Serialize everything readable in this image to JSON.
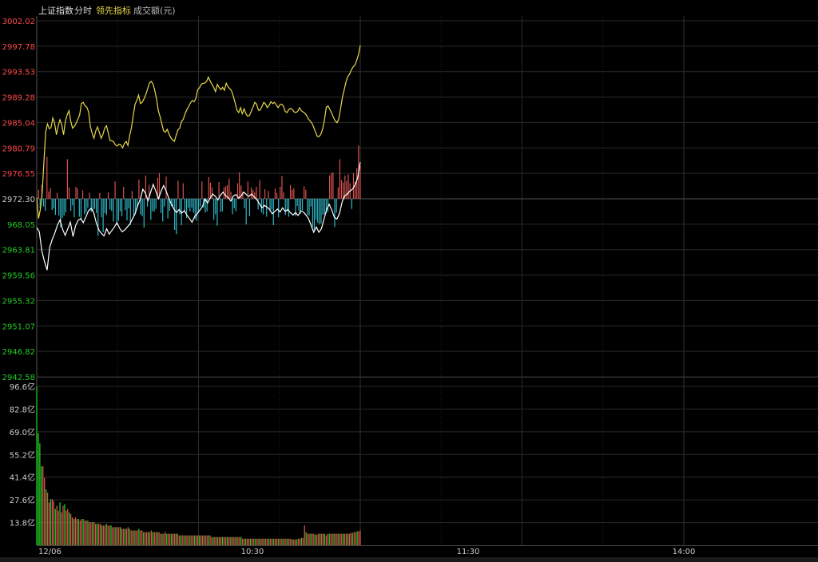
{
  "header": {
    "index_name": "上证指数",
    "tab_time": "分时",
    "tab_leading": "领先指标",
    "turnover_label": "成交额(元)"
  },
  "colors": {
    "up": "#ff4a4a",
    "down": "#22cc22",
    "price_line": "#ffffff",
    "lead_line": "#e8d84a",
    "bar_up": "#d9534f",
    "bar_down": "#2fb8c8",
    "grid": "#2a2a2a"
  },
  "chart_data": [
    {
      "type": "line",
      "panel": "price",
      "prev_close": 2972.3,
      "ylim": [
        2942.58,
        3002.02
      ],
      "y_ticks": [
        "3002.02",
        "2997.78",
        "2993.53",
        "2989.28",
        "2985.04",
        "2980.79",
        "2976.55",
        "2972.30",
        "968.05",
        "2963.81",
        "2959.56",
        "2955.32",
        "2951.07",
        "2946.82",
        "2942.58"
      ],
      "x_labels": [
        "12/06",
        "10:30",
        "11:30",
        "14:00"
      ],
      "x_minutes_shown": 121,
      "x_minutes_total": 241,
      "series": [
        {
          "role": "price",
          "values": [
            2967.5,
            2966.8,
            2963.5,
            2961.8,
            2960.4,
            2964.2,
            2965.5,
            2966.6,
            2967.9,
            2968.8,
            2967.2,
            2966.2,
            2967.3,
            2968.4,
            2966.0,
            2967.8,
            2968.7,
            2969.0,
            2968.3,
            2969.3,
            2970.3,
            2970.7,
            2970.0,
            2968.3,
            2967.1,
            2966.5,
            2966.1,
            2967.3,
            2966.4,
            2967.0,
            2967.6,
            2968.3,
            2967.4,
            2966.8,
            2967.1,
            2967.6,
            2968.1,
            2969.0,
            2969.8,
            2971.2,
            2972.2,
            2973.9,
            2973.2,
            2972.0,
            2973.4,
            2974.7,
            2973.6,
            2972.3,
            2973.5,
            2974.5,
            2973.6,
            2972.4,
            2971.4,
            2970.6,
            2970.0,
            2970.5,
            2969.9,
            2970.3,
            2969.6,
            2969.0,
            2968.4,
            2969.3,
            2969.8,
            2970.4,
            2971.0,
            2972.3,
            2971.6,
            2972.4,
            2973.1,
            2972.7,
            2972.1,
            2972.9,
            2973.4,
            2972.8,
            2972.5,
            2971.9,
            2972.8,
            2973.0,
            2972.4,
            2972.8,
            2973.4,
            2973.0,
            2972.7,
            2973.1,
            2972.6,
            2972.2,
            2971.5,
            2970.8,
            2971.2,
            2970.9,
            2970.5,
            2969.8,
            2970.2,
            2970.6,
            2970.1,
            2970.8,
            2970.2,
            2970.5,
            2970.0,
            2969.6,
            2970.0,
            2969.5,
            2970.3,
            2970.1,
            2969.6,
            2969.0,
            2967.9,
            2966.7,
            2967.6,
            2966.7,
            2967.3,
            2968.9,
            2970.5,
            2971.4,
            2970.4,
            2969.2,
            2968.9,
            2969.9,
            2971.8,
            2972.8,
            2973.1,
            2973.6,
            2973.9,
            2974.6,
            2975.8,
            2978.4
          ],
          "color": "#ffffff"
        },
        {
          "role": "leading",
          "values": [
            2972.5,
            2969.0,
            2970.5,
            2973.0,
            2978.5,
            2983.5,
            2984.8,
            2984.0,
            2984.2,
            2985.8,
            2984.9,
            2983.0,
            2984.5,
            2985.5,
            2984.6,
            2983.0,
            2985.2,
            2986.3,
            2987.0,
            2985.3,
            2984.1,
            2984.4,
            2984.9,
            2985.6,
            2986.3,
            2988.2,
            2988.4,
            2987.8,
            2987.6,
            2986.8,
            2984.4,
            2983.2,
            2982.4,
            2983.6,
            2984.3,
            2983.4,
            2982.4,
            2983.0,
            2984.1,
            2984.5,
            2983.3,
            2982.0,
            2982.0,
            2981.8,
            2981.3,
            2981.1,
            2981.4,
            2981.3,
            2980.8,
            2981.5,
            2981.9,
            2981.2,
            2982.9,
            2984.2,
            2986.2,
            2988.1,
            2988.7,
            2989.6,
            2988.2,
            2988.4,
            2989.0,
            2989.7,
            2990.6,
            2991.6,
            2991.9,
            2991.5,
            2990.4,
            2989.0,
            2987.0,
            2986.0,
            2984.8,
            2983.6,
            2983.4,
            2983.9,
            2983.1,
            2982.5,
            2982.1,
            2981.9,
            2982.9,
            2983.8,
            2984.1,
            2985.2,
            2985.6,
            2986.5,
            2987.2,
            2987.7,
            2988.3,
            2988.7,
            2988.5,
            2989.0,
            2990.5,
            2990.8,
            2991.4,
            2991.6,
            2991.6,
            2991.9,
            2992.6,
            2992.0,
            2991.4,
            2990.9,
            2990.2,
            2991.4,
            2990.9,
            2990.5,
            2990.9,
            2990.4,
            2991.6,
            2991.0,
            2990.7,
            2990.3,
            2989.4,
            2988.3,
            2987.1,
            2986.7,
            2987.5,
            2986.5,
            2987.3,
            2986.5,
            2986.1,
            2986.2,
            2986.9,
            2987.6,
            2988.4,
            2988.1,
            2987.1,
            2987.1,
            2987.7,
            2988.4,
            2988.1,
            2987.5,
            2987.9,
            2988.5,
            2988.2,
            2988.4,
            2988.0,
            2987.5,
            2988.0,
            2988.1,
            2987.8,
            2986.9,
            2986.7,
            2987.2,
            2987.4,
            2987.2,
            2986.8,
            2986.7,
            2986.9,
            2987.5,
            2987.0,
            2986.8,
            2986.6,
            2986.2,
            2985.6,
            2985.3,
            2984.9,
            2984.2,
            2983.4,
            2982.7,
            2982.7,
            2983.1,
            2984.0,
            2985.5,
            2987.6,
            2987.8,
            2987.2,
            2986.6,
            2985.9,
            2985.3,
            2985.0,
            2985.6,
            2987.4,
            2989.2,
            2990.5,
            2991.8,
            2992.7,
            2993.1,
            2993.8,
            2994.3,
            2994.6,
            2995.4,
            2996.4,
            2997.9
          ],
          "color": "#e8d84a"
        }
      ]
    },
    {
      "type": "bar",
      "panel": "leading_bars",
      "baseline": 2972.3,
      "values": [
        0,
        1.5,
        -1.6,
        2.3,
        -1.3,
        -2.0,
        7.0,
        1.2,
        1.8,
        -1.9,
        -1.6,
        -2.7,
        1.0,
        -2.8,
        -4.8,
        -3.2,
        -2.8,
        -2.3,
        6.6,
        1.9,
        -2.0,
        -1.1,
        -3.1,
        2.0,
        1.7,
        -3.0,
        -3.6,
        1.4,
        -2.6,
        -2.3,
        -1.5,
        1.0,
        -2.2,
        -2.0,
        -1.7,
        -2.4,
        -6.2,
        1.0,
        -3.1,
        -5.6,
        -2.4,
        -2.7,
        1.1,
        -1.8,
        -2.0,
        -3.8,
        2.9,
        -4.4,
        -3.7,
        -2.1,
        -2.9,
        2.0,
        -1.9,
        -3.6,
        -1.6,
        -4.4,
        1.3,
        -2.9,
        -2.5,
        -1.6,
        3.2,
        -2.6,
        -2.9,
        -4.8,
        3.9,
        -1.3,
        2.3,
        -3.5,
        -2.1,
        -2.1,
        -1.7,
        3.5,
        4.3,
        -2.4,
        -3.8,
        -1.3,
        3.7,
        -3.3,
        -2.0,
        -1.2,
        -1.5,
        -5.2,
        -5.9,
        3.0,
        -2.6,
        -4.4,
        2.6,
        -2.3,
        -3.2,
        -1.5,
        -2.1,
        -1.5,
        -2.3,
        -3.4,
        -3.7,
        -2.2,
        -1.3,
        2.9,
        -1.5,
        -2.3,
        -2.1,
        3.6,
        2.7,
        1.9,
        -3.5,
        -2.6,
        -4.5,
        2.8,
        -2.2,
        -2.1,
        1.9,
        2.1,
        2.3,
        3.4,
        1.2,
        -2.6,
        -1.6,
        -2.1,
        2.6,
        4.4,
        2.2,
        1.2,
        -1.6,
        -4.3,
        2.9,
        -2.9,
        1.9,
        1.5,
        1.1,
        2.0,
        -1.8,
        3.1,
        -2.3,
        -2.6,
        1.6,
        -3.0,
        1.3,
        -2.1,
        -1.8,
        -4.4,
        1.7,
        1.0,
        -3.1,
        2.0,
        3.8,
        1.1,
        -2.7,
        -2.1,
        -3.0,
        2.3,
        1.5,
        1.8,
        -2.9,
        -1.2,
        -2.0,
        -2.5,
        -1.9,
        2.1,
        1.5,
        -2.7,
        -2.8,
        -1.3,
        -4.7,
        -5.4,
        -3.5,
        -4.0,
        -4.3,
        -4.1,
        -2.7,
        -2.6,
        -2.4,
        -2.2,
        3.9,
        4.3,
        4.4,
        -4.7,
        -2.3,
        1.9,
        6.6,
        3.1,
        2.7,
        3.9,
        3.0,
        4.1,
        2.6,
        -1.7,
        4.3,
        2.8,
        5.1,
        8.9,
        5.5
      ]
    },
    {
      "type": "bar",
      "panel": "turnover",
      "unit": "亿",
      "ylim": [
        0,
        96.6
      ],
      "y_ticks": [
        "96.6亿",
        "82.8亿",
        "69.0亿",
        "55.2亿",
        "41.4亿",
        "27.6亿",
        "13.8亿"
      ],
      "values": [
        96.6,
        68,
        62,
        48,
        48,
        41,
        34,
        32,
        26,
        28,
        28,
        27,
        22,
        24,
        21,
        26,
        20,
        24,
        25,
        21,
        22,
        20,
        19,
        17,
        16,
        17,
        16,
        16,
        15,
        16,
        16,
        15,
        15,
        15,
        14,
        14,
        14,
        14,
        13,
        13,
        13,
        13,
        12,
        12,
        12,
        13,
        12,
        12,
        12,
        11,
        11,
        11,
        11,
        11,
        11,
        10,
        10,
        10,
        10,
        11,
        10,
        9,
        9,
        9,
        9,
        9,
        10,
        9,
        9,
        8,
        8,
        8,
        8,
        8,
        9,
        8,
        8,
        8,
        8,
        8,
        7,
        7,
        7,
        8,
        7,
        7,
        7,
        7,
        7,
        7,
        7,
        7,
        6,
        6,
        6,
        6,
        6,
        6,
        6,
        6,
        6,
        6,
        6,
        6,
        6,
        6,
        6,
        6,
        6,
        6,
        6,
        6,
        6,
        5,
        5,
        5,
        5,
        5,
        5,
        5,
        5,
        5,
        5,
        5,
        5,
        5,
        5,
        5,
        5,
        5,
        5,
        5,
        5,
        4,
        4,
        4,
        4,
        4,
        4,
        4,
        4,
        4,
        4,
        4,
        4,
        4,
        4,
        4,
        4,
        4,
        4,
        4,
        4,
        4,
        4,
        4,
        4,
        4,
        4,
        4,
        4,
        4,
        4,
        4,
        4,
        3.5,
        3.5,
        3.5,
        3.5,
        4,
        4,
        4.5,
        4.5,
        12,
        8,
        7,
        7,
        7,
        7,
        7,
        6.5,
        6.5,
        7,
        7,
        7,
        7,
        7,
        6,
        7,
        7,
        7,
        7,
        7,
        7,
        7,
        7,
        7,
        7,
        7,
        7,
        7,
        7,
        7,
        7.5,
        7.5,
        8,
        8,
        8.5,
        8.5,
        9
      ]
    }
  ]
}
